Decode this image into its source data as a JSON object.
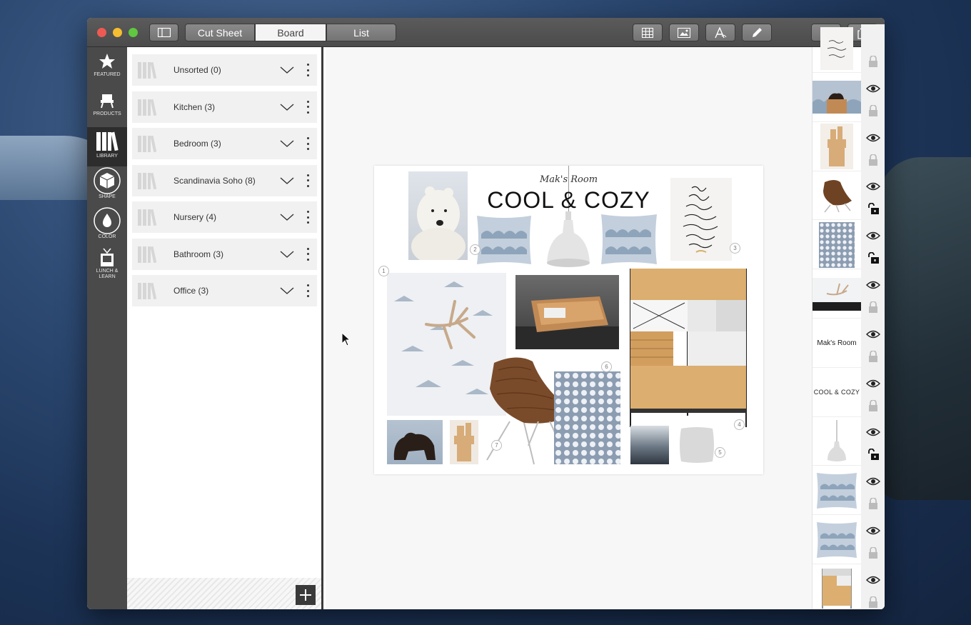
{
  "toolbar": {
    "tabs": [
      {
        "label": "Cut Sheet",
        "active": false
      },
      {
        "label": "Board",
        "active": true
      },
      {
        "label": "List",
        "active": false
      }
    ],
    "tool_icons": [
      "grid-icon",
      "image-icon",
      "text-icon",
      "pencil-icon",
      "collapse-icon",
      "share-icon"
    ]
  },
  "sidebar": {
    "items": [
      {
        "label": "FEATURED",
        "icon": "star-icon"
      },
      {
        "label": "PRODUCTS",
        "icon": "chair-icon"
      },
      {
        "label": "LIBRARY",
        "icon": "books-icon",
        "active": true
      },
      {
        "label": "SHAPE",
        "icon": "cube-icon"
      },
      {
        "label": "COLOR",
        "icon": "drop-icon"
      },
      {
        "label": "LUNCH &",
        "label2": "LEARN",
        "icon": "tv-icon"
      }
    ]
  },
  "library": {
    "categories": [
      {
        "label": "Unsorted (0)"
      },
      {
        "label": "Kitchen (3)"
      },
      {
        "label": "Bedroom (3)"
      },
      {
        "label": "Scandinavia Soho (8)"
      },
      {
        "label": "Nursery (4)"
      },
      {
        "label": "Bathroom (3)"
      },
      {
        "label": "Office (3)"
      }
    ]
  },
  "board": {
    "subtitle": "Mak's Room",
    "title": "COOL & COZY",
    "numbers": [
      "1",
      "2",
      "3",
      "4",
      "5",
      "6",
      "7"
    ]
  },
  "layers": {
    "items": [
      {
        "kind": "print",
        "visible": false,
        "locked": true
      },
      {
        "kind": "bear-pillow",
        "visible": true,
        "locked": true
      },
      {
        "kind": "wood-tower",
        "visible": true,
        "locked": true
      },
      {
        "kind": "chair",
        "visible": true,
        "locked": false
      },
      {
        "kind": "dots",
        "visible": true,
        "locked": false
      },
      {
        "kind": "antler",
        "visible": true,
        "locked": true
      },
      {
        "kind": "text",
        "text": "Mak's Room",
        "visible": true,
        "locked": true
      },
      {
        "kind": "text",
        "text": "COOL & COZY",
        "visible": true,
        "locked": true
      },
      {
        "kind": "lamp",
        "visible": true,
        "locked": false
      },
      {
        "kind": "pillow",
        "visible": true,
        "locked": true
      },
      {
        "kind": "pillow",
        "visible": true,
        "locked": true
      },
      {
        "kind": "shelf",
        "visible": true,
        "locked": true
      }
    ]
  },
  "colors": {
    "titlebar": "#4f4f4f",
    "iconbar": "#4a4a4a",
    "accent_wood": "#d9ad6b",
    "pillow_blue": "#9db2c8"
  }
}
